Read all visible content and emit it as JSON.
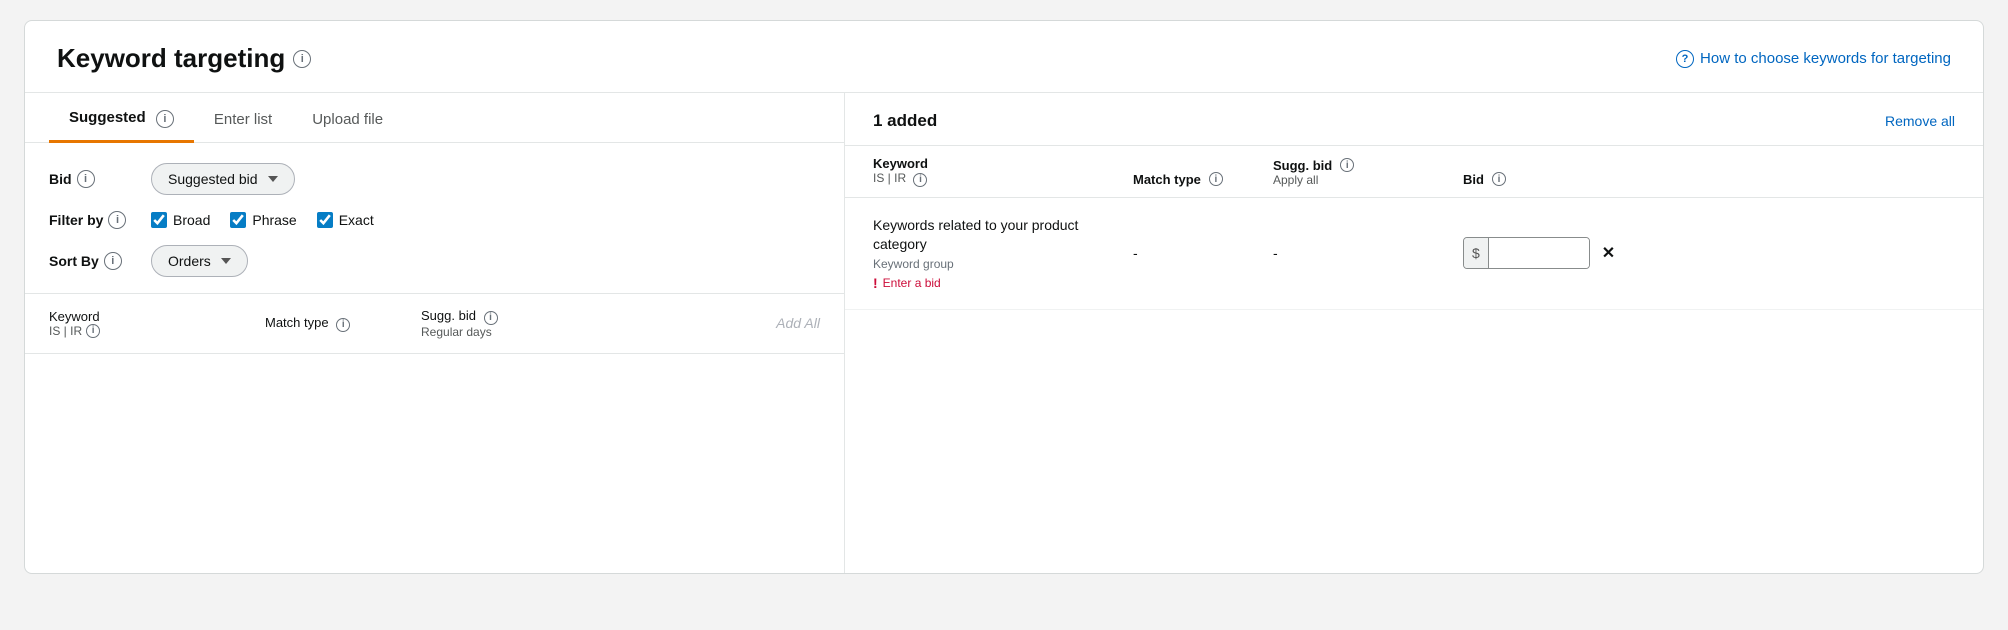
{
  "page": {
    "title": "Keyword targeting",
    "help_link": "How to choose keywords for targeting"
  },
  "tabs": [
    {
      "id": "suggested",
      "label": "Suggested",
      "active": true
    },
    {
      "id": "enter-list",
      "label": "Enter list",
      "active": false
    },
    {
      "id": "upload-file",
      "label": "Upload file",
      "active": false
    }
  ],
  "left_panel": {
    "bid_label": "Bid",
    "bid_dropdown": "Suggested bid",
    "filter_label": "Filter by",
    "filter_checkboxes": [
      {
        "id": "broad",
        "label": "Broad",
        "checked": true
      },
      {
        "id": "phrase",
        "label": "Phrase",
        "checked": true
      },
      {
        "id": "exact",
        "label": "Exact",
        "checked": true
      }
    ],
    "sort_label": "Sort By",
    "sort_dropdown": "Orders",
    "table_headers": {
      "keyword": "Keyword",
      "keyword_sub": "IS | IR",
      "match_type": "Match type",
      "sugg_bid": "Sugg. bid",
      "sugg_bid_sub": "Regular days",
      "add_all": "Add All"
    }
  },
  "right_panel": {
    "added_count": "1 added",
    "remove_all": "Remove all",
    "headers": {
      "keyword": "Keyword",
      "keyword_sub": "IS | IR",
      "match_type": "Match type",
      "sugg_bid": "Sugg. bid",
      "sugg_bid_sub": "Apply all",
      "bid": "Bid"
    },
    "rows": [
      {
        "keyword_main": "Keywords related to your product category",
        "keyword_group": "Keyword group",
        "match_type": "-",
        "sugg_bid": "-",
        "bid_placeholder": "$",
        "error": "Enter a bid"
      }
    ]
  }
}
